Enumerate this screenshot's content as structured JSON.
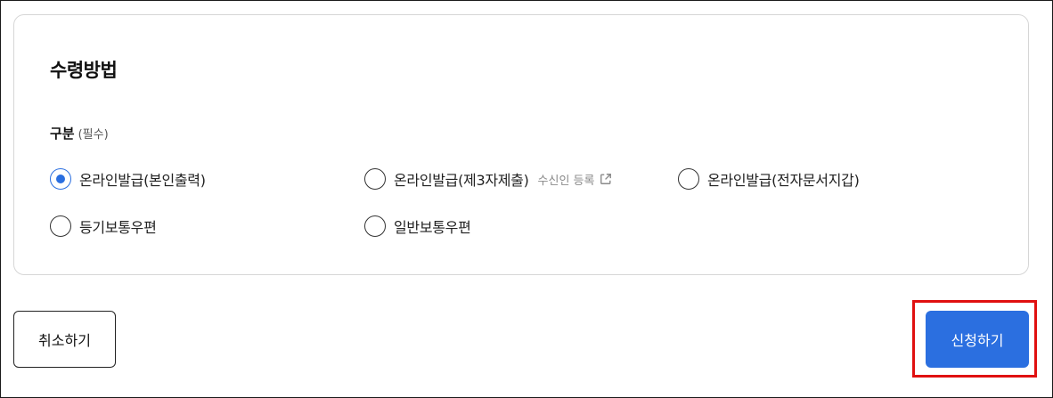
{
  "section": {
    "title": "수령방법"
  },
  "field": {
    "label": "구분",
    "required": "(필수)"
  },
  "options": [
    {
      "label": "온라인발급(본인출력)",
      "checked": true
    },
    {
      "label": "온라인발급(제3자제출)",
      "checked": false,
      "sub_link": "수신인 등록",
      "sub_icon": "external-link-icon"
    },
    {
      "label": "온라인발급(전자문서지갑)",
      "checked": false
    },
    {
      "label": "등기보통우편",
      "checked": false
    },
    {
      "label": "일반보통우편",
      "checked": false
    }
  ],
  "actions": {
    "cancel_label": "취소하기",
    "submit_label": "신청하기"
  },
  "colors": {
    "accent": "#2b6fe0",
    "highlight": "#e01010",
    "border": "#d6d6d6"
  }
}
